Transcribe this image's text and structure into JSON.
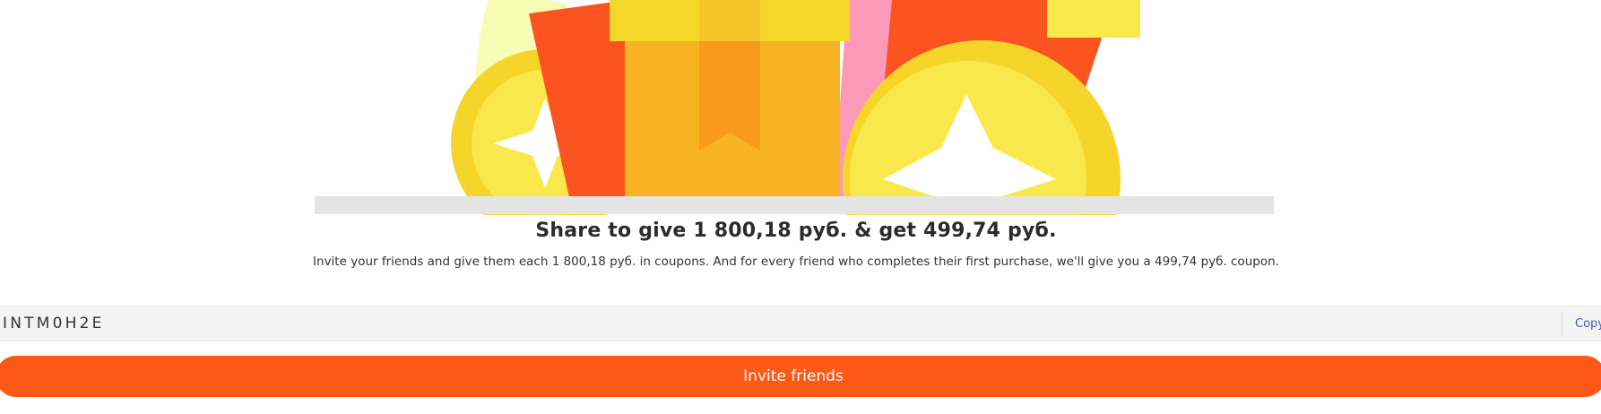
{
  "reward": {
    "headline": "Share to give 1 800,18 руб. & get 499,74 руб.",
    "description": "Invite your friends and give them each 1 800,18 руб. in coupons. And for every friend who completes their first purchase, we'll give you a 499,74 руб. coupon."
  },
  "invite_code": {
    "code": "INTM0H2E",
    "copy_label": "Copy"
  },
  "actions": {
    "invite_label": "Invite friends"
  },
  "colors": {
    "accent": "#fc5818",
    "link": "#3b5bb5",
    "gift_box": "#f7b324",
    "ribbon": "#f7d62a",
    "red_envelope": "#fb5421",
    "coin": "#f6d52b"
  }
}
